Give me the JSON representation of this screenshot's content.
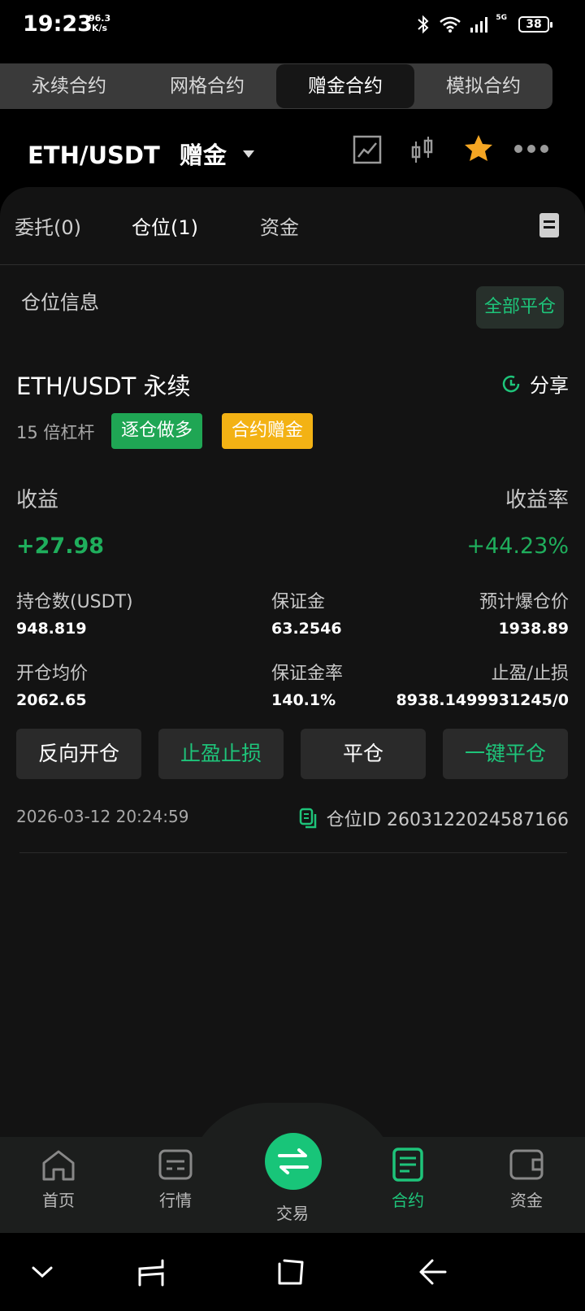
{
  "status": {
    "time": "19:23",
    "speed": "96.3",
    "speed_unit": "K/s",
    "network": "5G",
    "battery": "38"
  },
  "contract_tabs": [
    {
      "label": "永续合约"
    },
    {
      "label": "网格合约"
    },
    {
      "label": "赠金合约"
    },
    {
      "label": "模拟合约"
    }
  ],
  "header": {
    "pair": "ETH/USDT",
    "mode": "赠金"
  },
  "sub_tabs": [
    {
      "label": "委托(0)"
    },
    {
      "label": "仓位(1)"
    },
    {
      "label": "资金"
    }
  ],
  "section": {
    "title": "仓位信息",
    "close_all": "全部平仓"
  },
  "position": {
    "name": "ETH/USDT 永续",
    "share": "分享",
    "leverage": "15 倍杠杆",
    "tag_side": "逐仓做多",
    "tag_bonus": "合约赠金",
    "pnl_label": "收益",
    "pnl_rate_label": "收益率",
    "pnl": "+27.98",
    "pnl_rate": "+44.23%",
    "size_label": "持仓数(USDT)",
    "size": "948.819",
    "margin_label": "保证金",
    "margin": "63.2546",
    "liq_label": "预计爆仓价",
    "liq": "1938.89",
    "entry_label": "开仓均价",
    "entry": "2062.65",
    "margin_rate_label": "保证金率",
    "margin_rate": "140.1%",
    "tpsl_label": "止盈/止损",
    "tpsl": "8938.1499931245/0",
    "btn_reverse": "反向开仓",
    "btn_tpsl": "止盈止损",
    "btn_close": "平仓",
    "btn_quick_close": "一键平仓",
    "time": "2026-03-12 20:24:59",
    "position_id": "仓位ID 2603122024587166"
  },
  "bottom_nav": [
    {
      "label": "首页",
      "icon": "home-icon"
    },
    {
      "label": "行情",
      "icon": "market-icon"
    },
    {
      "label": "交易",
      "icon": "swap-icon"
    },
    {
      "label": "合约",
      "icon": "contract-icon"
    },
    {
      "label": "资金",
      "icon": "wallet-icon"
    }
  ],
  "colors": {
    "accent_green": "#1ec47a",
    "tag_yellow": "#f3b214",
    "tag_green": "#1fa654"
  }
}
